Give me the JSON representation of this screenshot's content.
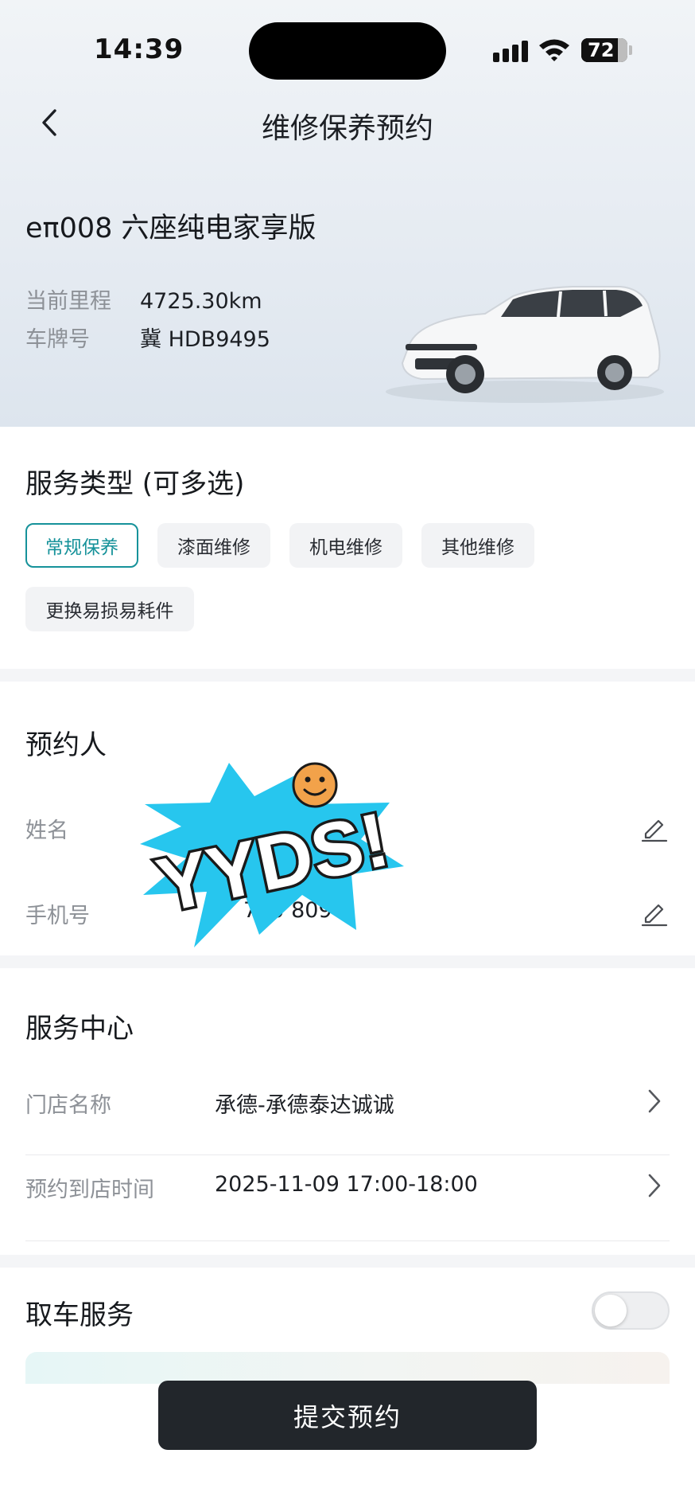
{
  "status_bar": {
    "time": "14:39",
    "battery": "72"
  },
  "header": {
    "title": "维修保养预约"
  },
  "vehicle": {
    "name": "eπ008 六座纯电家享版",
    "mileage_label": "当前里程",
    "mileage_value": "4725.30km",
    "plate_label": "车牌号",
    "plate_value": "冀 HDB9495"
  },
  "service_type": {
    "title": "服务类型 (可多选)",
    "options": [
      "常规保养",
      "漆面维修",
      "机电维修",
      "其他维修",
      "更换易损易耗件"
    ],
    "selected": "常规保养"
  },
  "booker": {
    "title": "预约人",
    "name_label": "姓名",
    "phone_label": "手机号",
    "phone_value": "720 809"
  },
  "sticker_text": "YYDS!",
  "service_center": {
    "title": "服务中心",
    "store_label": "门店名称",
    "store_value": "承德-承德泰达诚诚",
    "time_label": "预约到店时间",
    "time_value": "2025-11-09 17:00-18:00"
  },
  "pickup": {
    "title": "取车服务",
    "enabled": false
  },
  "submit_label": "提交预约",
  "colors": {
    "accent": "#16929a",
    "button_bg": "#22262b",
    "separator": "#f4f5f7",
    "muted_text": "#8d9197"
  }
}
